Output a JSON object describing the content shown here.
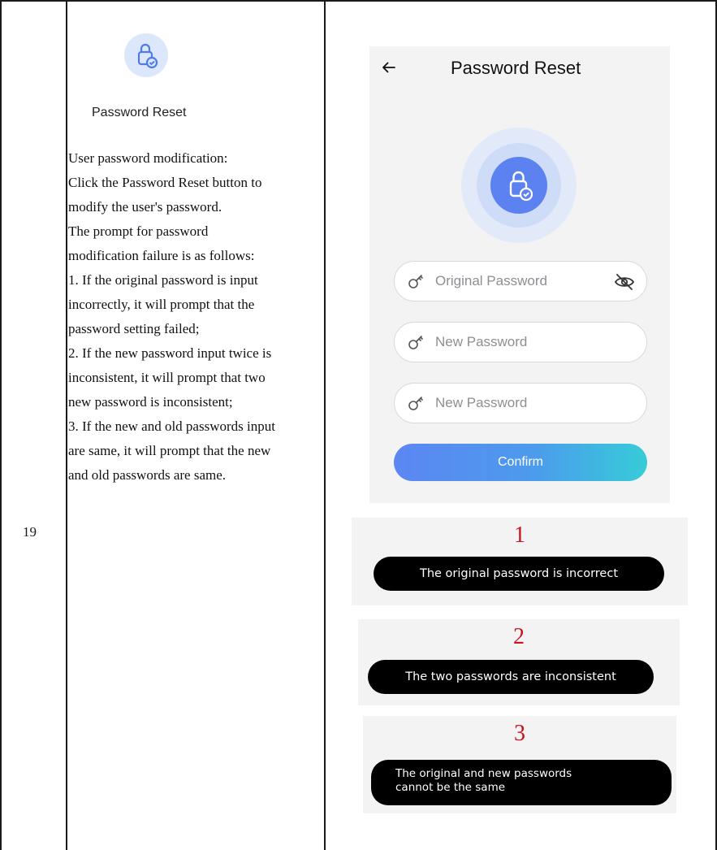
{
  "row": {
    "number": "19"
  },
  "left": {
    "icon": "lock-check-icon",
    "label": "Password Reset",
    "lines": [
      "User password modification:",
      "Click the Password Reset button to",
      "modify the user's password.",
      "The prompt for password",
      "modification failure is as follows:",
      "1. If the original password is input",
      "incorrectly, it will prompt that the",
      "password setting failed;",
      "2. If the new password input twice is",
      "inconsistent, it will prompt that two",
      "new password is inconsistent;",
      "3. If the new and old passwords input",
      "are same, it will prompt that the new",
      "and old passwords are same."
    ]
  },
  "phone": {
    "title": "Password Reset",
    "back_icon": "back-arrow-icon",
    "fields": [
      {
        "placeholder": "Original Password",
        "icon": "key-icon",
        "eye_icon": "eye-off-icon"
      },
      {
        "placeholder": "New Password",
        "icon": "key-icon"
      },
      {
        "placeholder": "New Password",
        "icon": "key-icon"
      }
    ],
    "confirm_label": "Confirm"
  },
  "toasts": [
    {
      "number": "1",
      "lines": [
        "The original password is incorrect"
      ]
    },
    {
      "number": "2",
      "lines": [
        "The two passwords are inconsistent"
      ]
    },
    {
      "number": "3",
      "lines": [
        "The original and new passwords",
        "cannot be the same"
      ]
    }
  ],
  "colors": {
    "accent_blue": "#5b82f0",
    "gradient_end": "#36ccd8",
    "toast_number_red": "#c8141e"
  }
}
